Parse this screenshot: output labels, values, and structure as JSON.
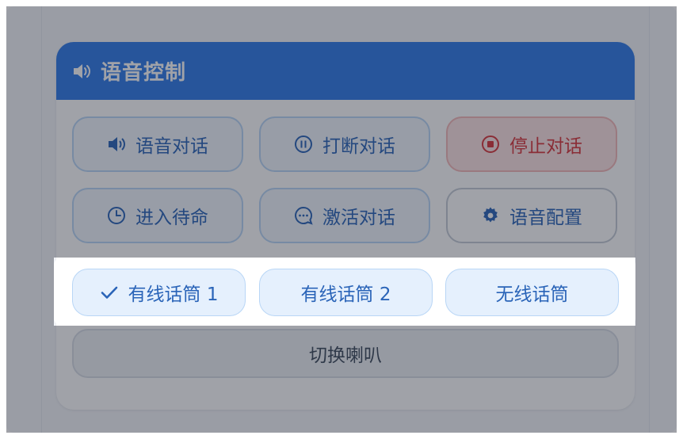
{
  "panel": {
    "title": "语音控制",
    "icon": "speaker-icon",
    "header_color": "#2f7be8"
  },
  "controls": {
    "row1": [
      {
        "label": "语音对话",
        "icon": "speaker-icon"
      },
      {
        "label": "打断对话",
        "icon": "pause-circle-icon"
      },
      {
        "label": "停止对话",
        "icon": "stop-circle-icon"
      }
    ],
    "row2": [
      {
        "label": "进入待命",
        "icon": "clock-icon"
      },
      {
        "label": "激活对话",
        "icon": "chat-bubble-icon"
      },
      {
        "label": "语音配置",
        "icon": "gear-icon"
      }
    ],
    "switch_speaker": "切换喇叭"
  },
  "mics": {
    "options": [
      {
        "label": "有线话筒 1",
        "selected": true
      },
      {
        "label": "有线话筒 2",
        "selected": false
      },
      {
        "label": "无线话筒",
        "selected": false
      }
    ],
    "accent": "#2a64b8"
  },
  "colors": {
    "stop": "#d9363b",
    "button_border": "#b9d6f6"
  }
}
